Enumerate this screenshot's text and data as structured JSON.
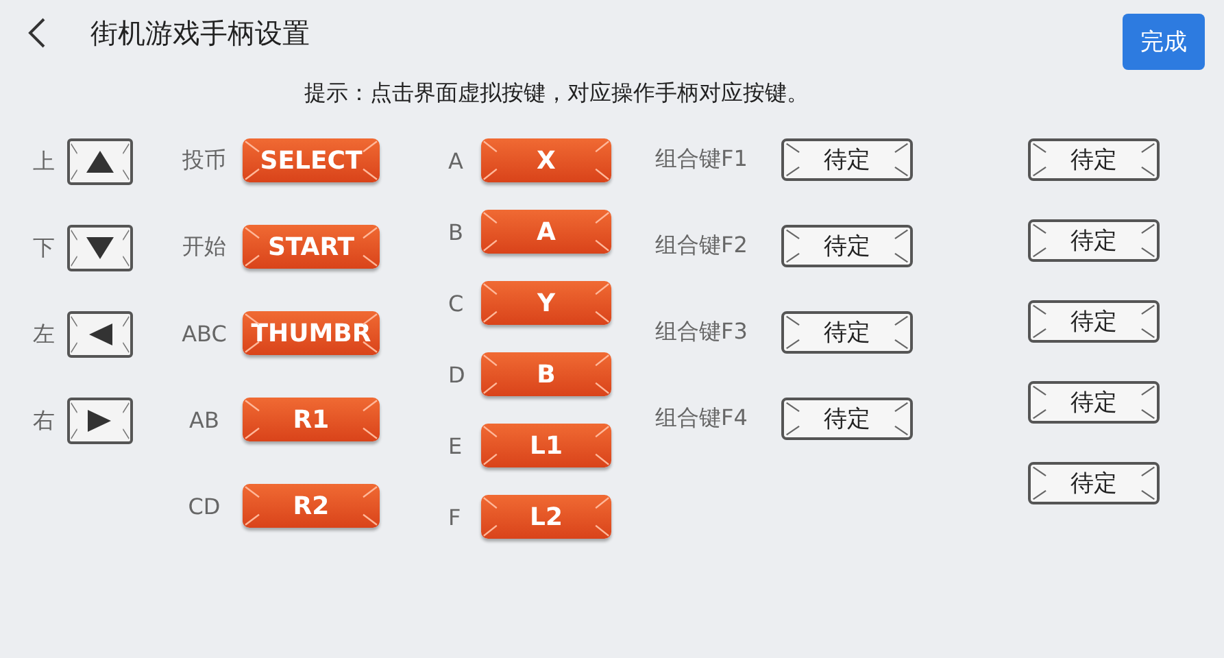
{
  "header": {
    "title": "街机游戏手柄设置",
    "done_button": "完成"
  },
  "hint": "提示：点击界面虚拟按键，对应操作手柄对应按键。",
  "direction_keys": [
    {
      "label": "上",
      "kind": "up"
    },
    {
      "label": "下",
      "kind": "down"
    },
    {
      "label": "左",
      "kind": "left"
    },
    {
      "label": "右",
      "kind": "right"
    }
  ],
  "function_keys": [
    {
      "label": "投币",
      "key": "SELECT"
    },
    {
      "label": "开始",
      "key": "START"
    },
    {
      "label": "ABC",
      "key": "THUMBR"
    },
    {
      "label": "AB",
      "key": "R1"
    },
    {
      "label": "CD",
      "key": "R2"
    }
  ],
  "letter_keys": [
    {
      "label": "A",
      "key": "X"
    },
    {
      "label": "B",
      "key": "A"
    },
    {
      "label": "C",
      "key": "Y"
    },
    {
      "label": "D",
      "key": "B"
    },
    {
      "label": "E",
      "key": "L1"
    },
    {
      "label": "F",
      "key": "L2"
    }
  ],
  "combo_keys": [
    {
      "label": "组合键F1",
      "key": "待定"
    },
    {
      "label": "组合键F2",
      "key": "待定"
    },
    {
      "label": "组合键F3",
      "key": "待定"
    },
    {
      "label": "组合键F4",
      "key": "待定"
    }
  ],
  "extra_keys": [
    {
      "key": "待定"
    },
    {
      "key": "待定"
    },
    {
      "key": "待定"
    },
    {
      "key": "待定"
    },
    {
      "key": "待定"
    }
  ]
}
